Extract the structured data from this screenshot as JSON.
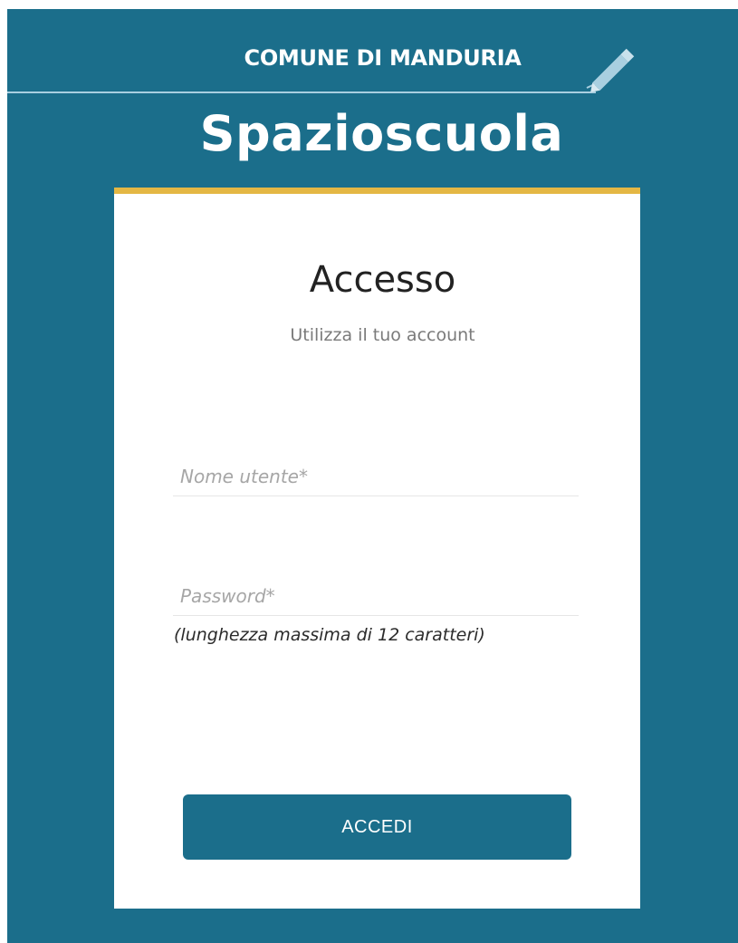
{
  "header": {
    "municipality": "COMUNE DI MANDURIA",
    "brand": "Spazioscuola",
    "icon": "pencil-icon"
  },
  "login": {
    "title": "Accesso",
    "subtitle": "Utilizza il tuo account",
    "username": {
      "placeholder": "Nome utente*",
      "value": ""
    },
    "password": {
      "placeholder": "Password*",
      "value": ""
    },
    "password_hint": "(lunghezza massima di 12 caratteri)",
    "submit_label": "ACCEDI"
  },
  "colors": {
    "background": "#1b6e8b",
    "accent_bar": "#e4b744",
    "card": "#ffffff",
    "button": "#1b6e8b"
  }
}
